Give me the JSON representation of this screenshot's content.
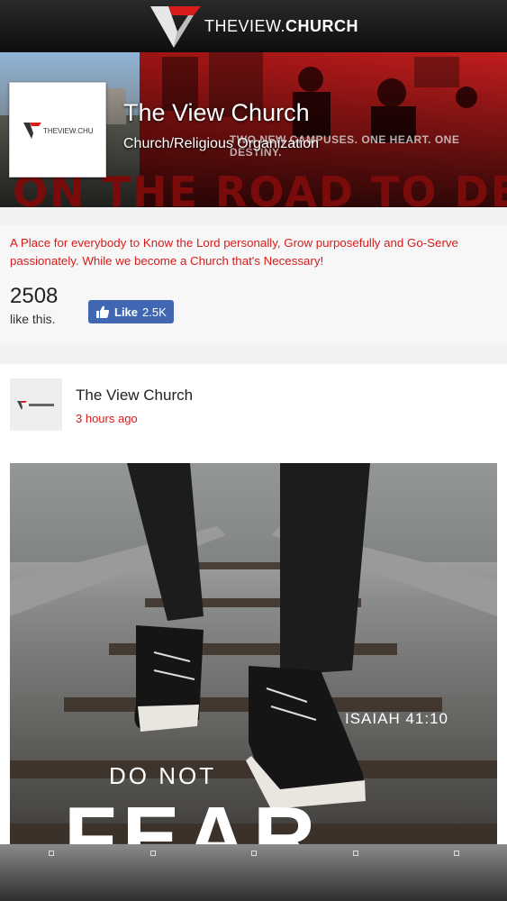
{
  "header": {
    "logo_text_light": "THEVIEW.",
    "logo_text_bold": "CHURCH"
  },
  "cover": {
    "page_name": "The View Church",
    "category": "Church/Religious Organization",
    "tagline": "TWO NEW CAMPUSES. ONE HEART. ONE DESTINY.",
    "big_text": "ON THE ROAD TO DESTINY"
  },
  "info": {
    "description": "A Place for everybody to Know the Lord personally, Grow purposefully and Go-Serve passionately. While we become a Church that's Necessary!",
    "like_count": "2508",
    "like_count_label": "like this.",
    "like_button_label": "Like",
    "like_button_count": "2.5K"
  },
  "post": {
    "author": "The View Church",
    "time": "3 hours ago",
    "image_verse": "ISAIAH 41:10",
    "image_line1": "DO NOT",
    "image_line2": "FEAR"
  },
  "colors": {
    "accent_red": "#d81b1b",
    "facebook_blue": "#4267b2"
  },
  "icons": [
    "the-view-church-logo-icon",
    "thumbs-up-icon"
  ]
}
